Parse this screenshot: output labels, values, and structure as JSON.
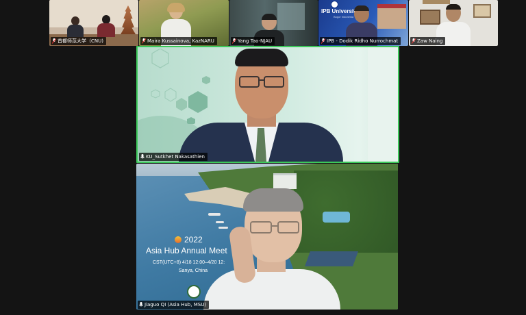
{
  "participants": [
    {
      "name": "首都师范大学（CNU)"
    },
    {
      "name": "Maira Kussainova, KazNARU"
    },
    {
      "name": "Yang Tao-NJAU"
    },
    {
      "name": "IPB - Dodik Ridho Nurrochmat"
    },
    {
      "name": "Zaw Naing"
    }
  ],
  "speaker_active": {
    "name": "KU_Sutkhet Nakasathien"
  },
  "speaker_share": {
    "name": "Jiaguo QI (Asia Hub, MSU)"
  },
  "ipb_banner": "IPB University",
  "ipb_sub": "Bogor Indonesia",
  "meeting": {
    "year": "2022",
    "title": "Asia Hub Annual Meet",
    "time": "CST(UTC+8) 4/18 12:00–4/20 12:",
    "place": "Sanya, China"
  },
  "colors": {
    "active_border": "#3cc95a",
    "mint": "#c8e6da"
  }
}
